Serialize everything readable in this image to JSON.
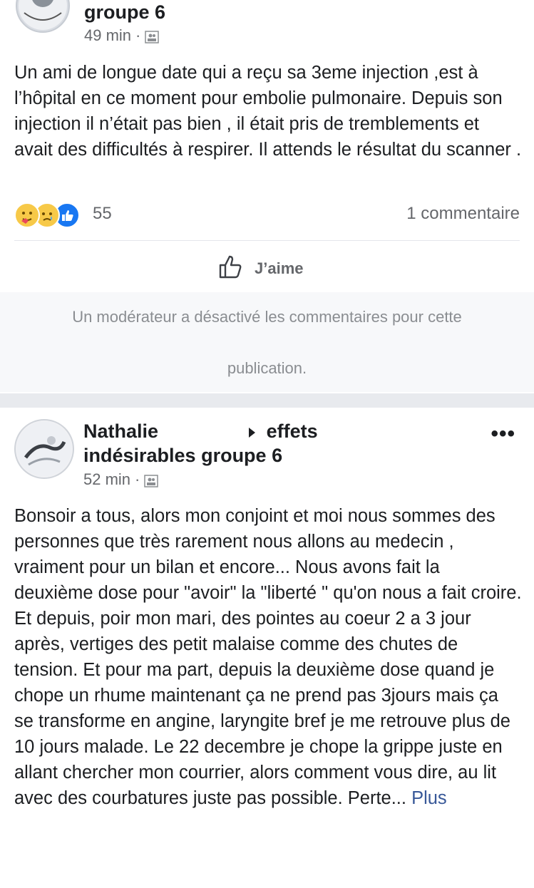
{
  "post1": {
    "group_name": "groupe 6",
    "time": "49 min",
    "dot": "·",
    "text": "Un ami de longue date qui a reçu sa 3eme injection ,est à l’hôpital en ce moment pour embolie pulmonaire. Depuis son injection il n’était pas bien , il était pris de tremblements et avait des difficultés à respirer. Il attends le résultat du scanner .",
    "reaction_count": "55",
    "comments": "1 commentaire",
    "like_label": "J’aime",
    "notice_line1": "Un modérateur a désactivé les commentaires pour cette",
    "notice_line2": "publication."
  },
  "post2": {
    "author_line1_a": "Nathalie",
    "author_line1_b": "effets",
    "author_line2": "indésirables groupe 6",
    "time": "52 min",
    "dot": "·",
    "more": "•••",
    "text": "Bonsoir a tous, alors mon conjoint et moi nous sommes des personnes que très rarement nous allons au medecin , vraiment pour un bilan et encore... Nous avons fait la deuxième dose pour \"avoir\" la \"liberté \" qu'on nous a fait croire. Et depuis, poir mon mari, des pointes au coeur 2 a 3 jour après, vertiges des petit malaise comme des chutes de tension. Et pour ma part, depuis la deuxième dose quand je chope un rhume maintenant ça ne prend pas 3jours mais ça se transforme en angine, laryngite bref je me retrouve plus de 10 jours malade. Le 22 decembre je chope la grippe juste en allant chercher mon courrier, alors comment vous dire, au lit avec des courbatures juste pas possible. Perte...",
    "more_link": "Plus"
  },
  "colors": {
    "accent": "#385898",
    "secondary_text": "#65676b",
    "like_blue": "#1877f2"
  }
}
